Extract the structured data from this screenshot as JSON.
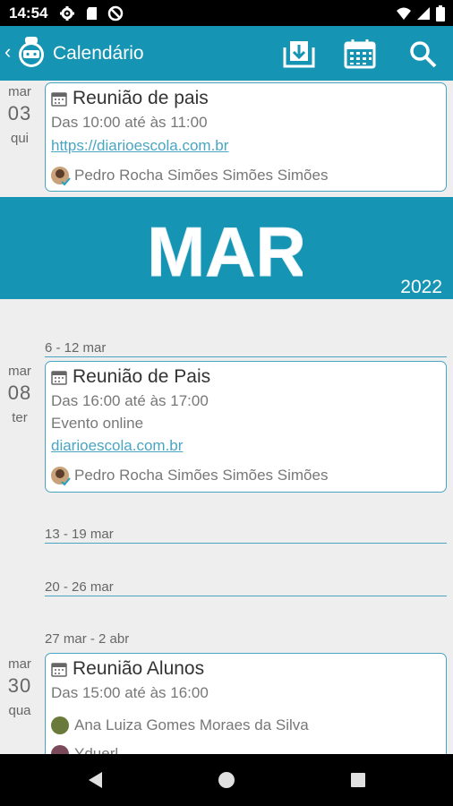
{
  "status_bar": {
    "time": "14:54"
  },
  "app_bar": {
    "title": "Calendário"
  },
  "events": [
    {
      "month": "mar",
      "day": "03",
      "weekday": "qui",
      "title": "Reunião de pais",
      "time": "Das 10:00 até às 11:00",
      "link": "https://diarioescola.com.br",
      "person": "Pedro Rocha Simões Simões Simões"
    },
    {
      "month": "mar",
      "day": "08",
      "weekday": "ter",
      "title": "Reunião de Pais",
      "time": "Das 16:00 até às 17:00",
      "location": "Evento online",
      "link": "diarioescola.com.br",
      "person": "Pedro Rocha Simões Simões Simões"
    },
    {
      "month": "mar",
      "day": "30",
      "weekday": "qua",
      "title": "Reunião Alunos",
      "time": "Das 15:00 até às 16:00",
      "person": "Ana Luiza Gomes Moraes da Silva",
      "person2": "Yduerl"
    }
  ],
  "month_banner": {
    "month": "MAR",
    "year": "2022"
  },
  "weeks": [
    "6 - 12 mar",
    "13 - 19 mar",
    "20 - 26 mar",
    "27 mar - 2 abr"
  ],
  "colors": {
    "accent": "#1594b4",
    "card_border": "#4aa5c2",
    "link": "#4aa5c2"
  }
}
